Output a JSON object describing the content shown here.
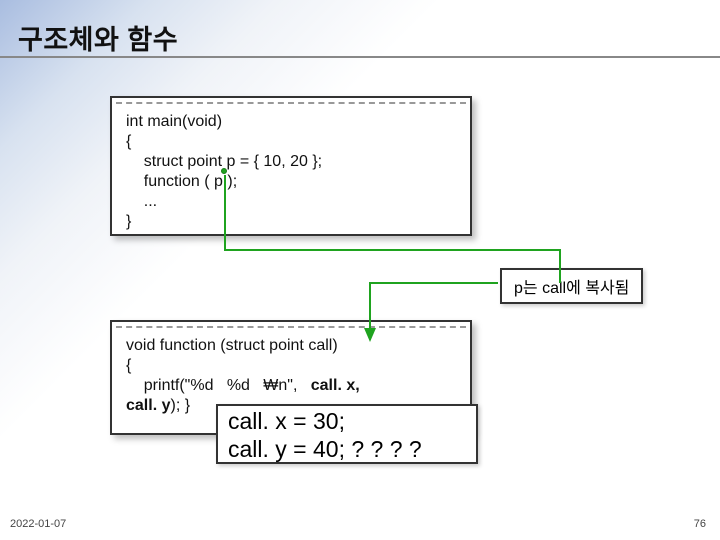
{
  "title": "구조체와 함수",
  "code1": {
    "l1": "int main(void)",
    "l2": "{",
    "l3": "    struct point p = { 10, 20 };",
    "l4": "    function ( p );",
    "l5": "    ...",
    "l6": "}"
  },
  "label_copy": "p는 call에 복사됨",
  "code2": {
    "l1": "void function (struct point call)",
    "l2": "{",
    "l3_a": "    printf(\"%d   %d   ",
    "l3_b": "n\",   ",
    "l3_c": "call. x,",
    "l4_a": "call. y",
    "l4_b": "); }"
  },
  "highlight": {
    "l1": "call. x = 30;",
    "l2": "call. y = 40;  ? ? ? ?"
  },
  "footer": {
    "date": "2022-01-07",
    "page": "76"
  },
  "colors": {
    "arrow": "#1fa31f",
    "box_border": "#333333"
  }
}
